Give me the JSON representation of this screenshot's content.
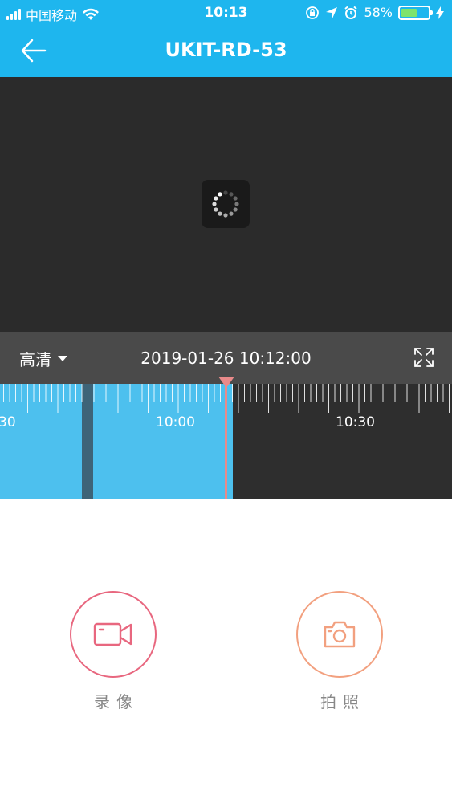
{
  "status_bar": {
    "carrier": "中国移动",
    "time": "10:13",
    "battery": "58%",
    "battery_level": 0.58
  },
  "header": {
    "title": "UKIT-RD-53"
  },
  "player": {
    "quality": "高清",
    "datetime": "2019-01-26 10:12:00"
  },
  "timeline": {
    "labels": [
      "30",
      "10:00",
      "10:30"
    ]
  },
  "actions": {
    "record_label": "录像",
    "photo_label": "拍照"
  },
  "colors": {
    "accent": "#1eb6ee",
    "record": "#e8677f",
    "photo": "#f2a07f",
    "playhead": "#e98a8a"
  }
}
